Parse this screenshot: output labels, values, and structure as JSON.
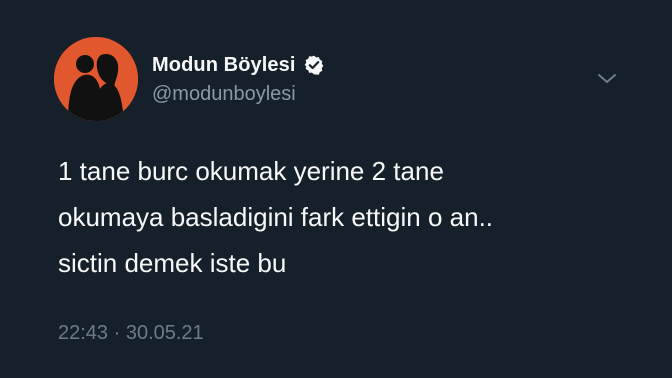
{
  "tweet": {
    "display_name": "Modun Böylesi",
    "handle": "@modunboylesi",
    "text": "1 tane burc okumak yerine 2 tane\nokumaya basladigini fark ettigin o an..\nsictin demek iste bu",
    "meta": "22:43 · 30.05.21"
  },
  "icons": {
    "verified": "verified-badge-icon",
    "more": "chevron-down-icon",
    "avatar": "couple-silhouette-avatar"
  },
  "colors": {
    "background": "#15202b",
    "avatar_bg": "#e2582e",
    "name": "#f7f9f9",
    "handle": "#8b98a5",
    "meta": "#6e7c89"
  }
}
